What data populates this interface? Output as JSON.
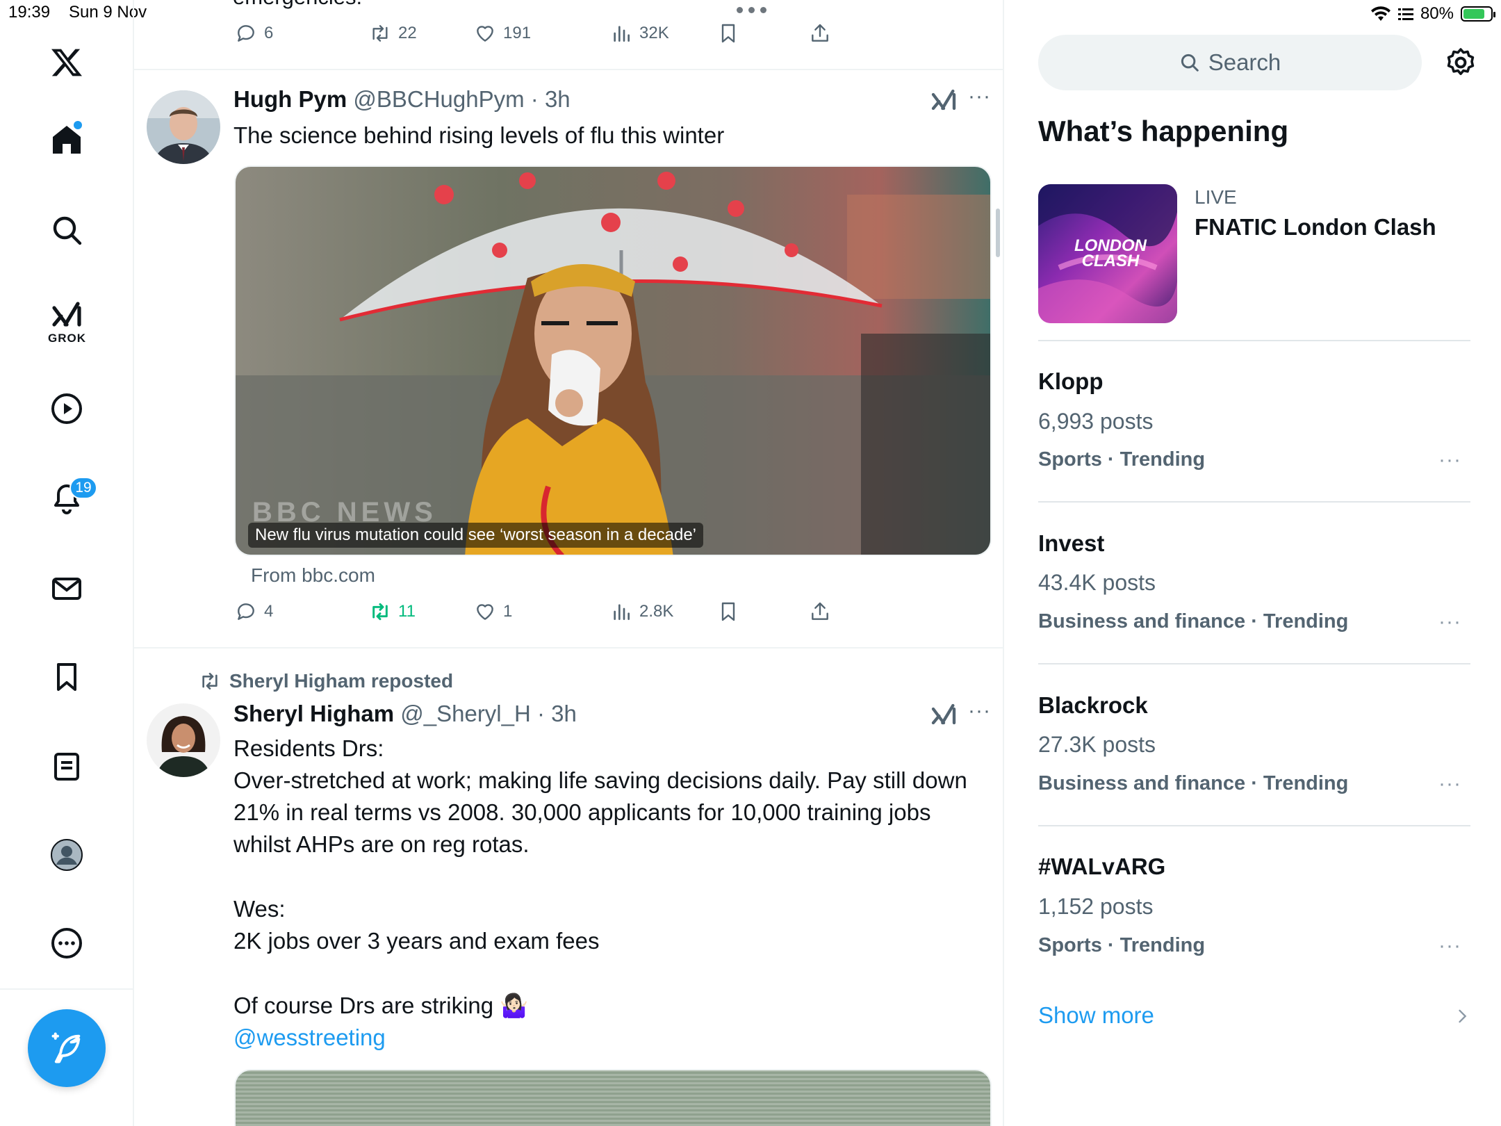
{
  "status": {
    "time": "19:39",
    "date": "Sun 9 Nov",
    "battery": "80%",
    "battery_level": 0.8
  },
  "nav": {
    "grok_label": "GROK",
    "notifications_badge": "19",
    "items": [
      "x-logo",
      "home",
      "search",
      "grok",
      "video",
      "notifications",
      "messages",
      "bookmarks",
      "lists",
      "profile",
      "more"
    ]
  },
  "feed": {
    "prev_tweet": {
      "text_tail": "emergencies.",
      "replies": "6",
      "reposts": "22",
      "likes": "191",
      "views": "32K"
    },
    "tweet1": {
      "name": "Hugh Pym",
      "handle": "@BBCHughPym",
      "time": "3h",
      "text": "The science behind rising levels of flu this winter",
      "card_caption": "New flu virus mutation could see ‘worst season in a decade’",
      "card_watermark": "BBC NEWS",
      "card_source": "From bbc.com",
      "replies": "4",
      "reposts": "11",
      "likes": "1",
      "views": "2.8K"
    },
    "tweet2": {
      "repost_by": "Sheryl Higham reposted",
      "name": "Sheryl Higham",
      "handle": "@_Sheryl_H",
      "time": "3h",
      "line1": "Residents Drs:",
      "line2": "Over-stretched at work; making life saving decisions daily. Pay still down 21% in real terms vs 2008. 30,000 applicants for 10,000 training jobs whilst AHPs are on reg rotas.",
      "line3": "Wes:",
      "line4": "2K jobs over 3 years and exam fees",
      "line5": "Of course Drs are striking 🤷🏻‍♀️",
      "mention": "@wesstreeting"
    }
  },
  "sidebar": {
    "search_placeholder": "Search",
    "section_title": "What’s happening",
    "live": {
      "label": "LIVE",
      "title": "FNATIC London Clash",
      "thumb_text": "LONDON CLASH"
    },
    "trends": [
      {
        "name": "Klopp",
        "posts": "6,993 posts",
        "meta": "Sports · Trending"
      },
      {
        "name": "Invest",
        "posts": "43.4K posts",
        "meta": "Business and finance · Trending"
      },
      {
        "name": "Blackrock",
        "posts": "27.3K posts",
        "meta": "Business and finance · Trending"
      },
      {
        "name": "#WALvARG",
        "posts": "1,152 posts",
        "meta": "Sports · Trending"
      }
    ],
    "show_more": "Show more"
  },
  "colors": {
    "accent": "#1d9bf0",
    "repost_green": "#00ba7c",
    "muted": "#536471"
  }
}
